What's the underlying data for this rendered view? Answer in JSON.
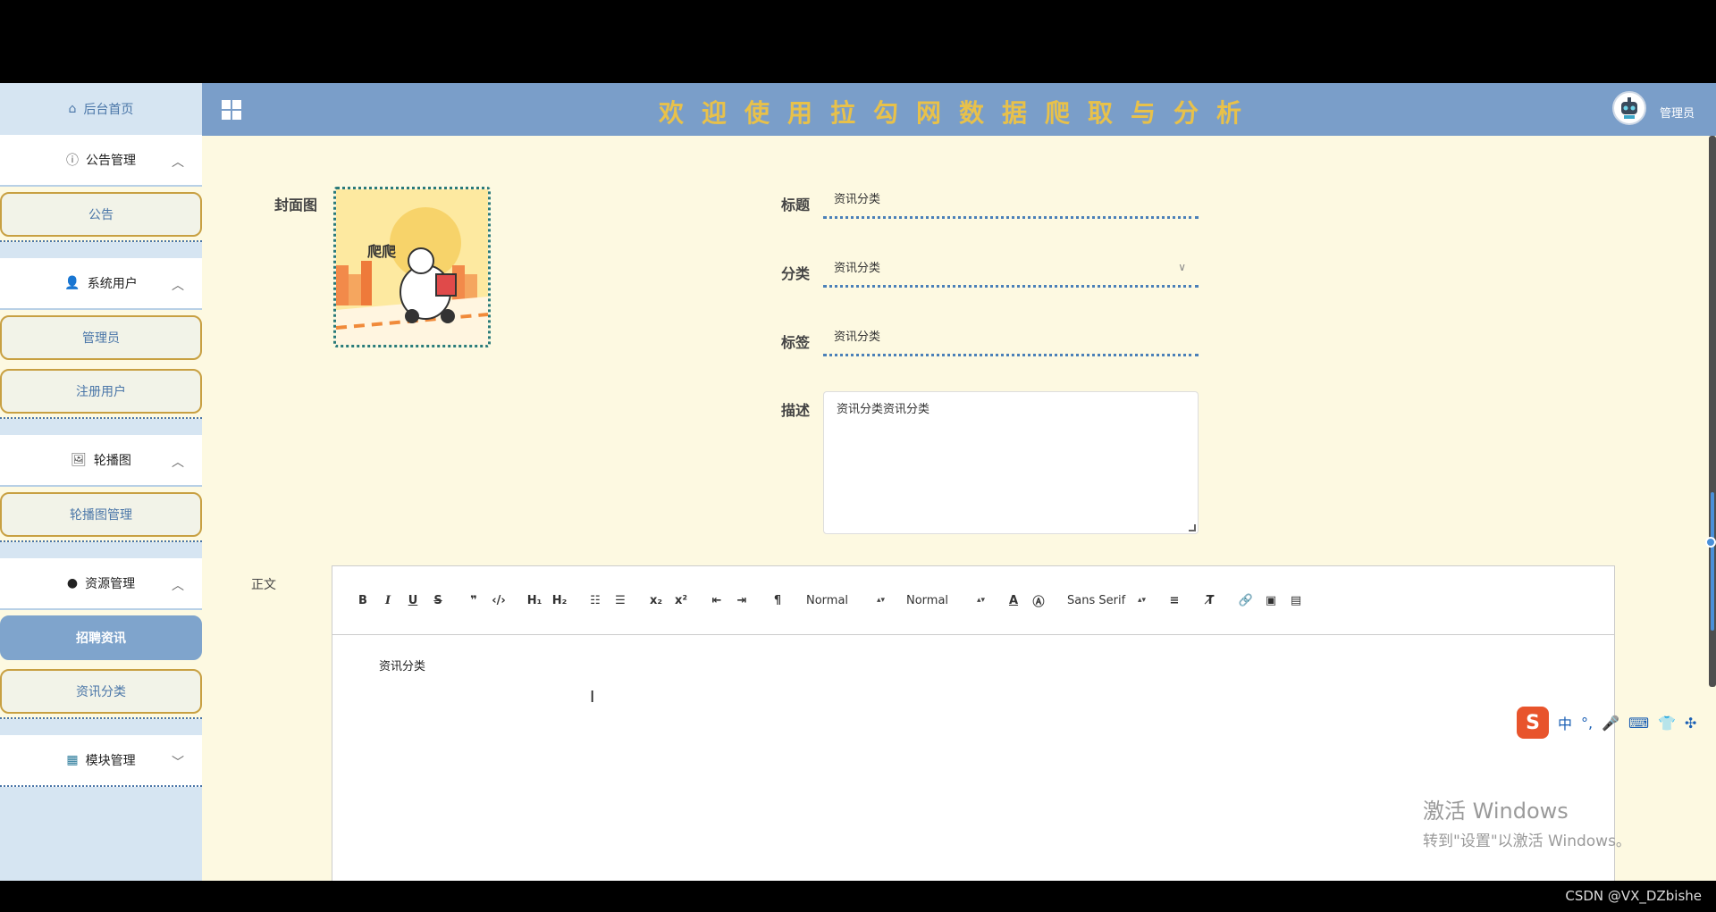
{
  "header": {
    "title": "欢迎使用拉勾网数据爬取与分析",
    "user_label": "管理员"
  },
  "sidebar": {
    "home": "后台首页",
    "groups": [
      {
        "label": "公告管理",
        "items": [
          "公告"
        ]
      },
      {
        "label": "系统用户",
        "items": [
          "管理员",
          "注册用户"
        ]
      },
      {
        "label": "轮播图",
        "items": [
          "轮播图管理"
        ]
      },
      {
        "label": "资源管理",
        "items": [
          "招聘资讯",
          "资讯分类"
        ]
      },
      {
        "label": "模块管理",
        "items": []
      }
    ],
    "active_item": "招聘资讯"
  },
  "form": {
    "cover_label": "封面图",
    "cover_text": "爬爬",
    "title_label": "标题",
    "title_value": "资讯分类",
    "category_label": "分类",
    "category_value": "资讯分类",
    "tag_label": "标签",
    "tag_value": "资讯分类",
    "desc_label": "描述",
    "desc_value": "资讯分类资讯分类",
    "body_label": "正文"
  },
  "editor": {
    "header_select": "Normal",
    "size_select": "Normal",
    "font_select": "Sans Serif",
    "content": "资讯分类"
  },
  "ime": {
    "logo": "S",
    "mode": "中"
  },
  "watermark": {
    "line1": "激活 Windows",
    "line2": "转到\"设置\"以激活 Windows。"
  },
  "footer": {
    "credit": "CSDN @VX_DZbishe"
  },
  "colors": {
    "header_bg": "#7a9ec9",
    "sidebar_bg": "#d6e5f2",
    "content_bg": "#fdf9e1",
    "accent_gold": "#c8a042",
    "active_item_bg": "#7fa4cc"
  }
}
